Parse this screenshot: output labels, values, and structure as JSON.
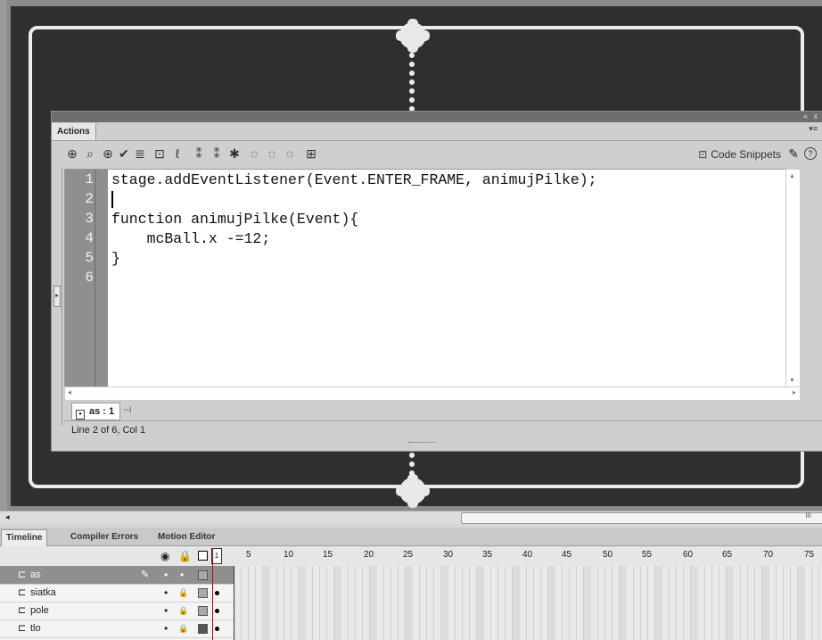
{
  "panel": {
    "tab_label": "Actions",
    "toolbar_icons": [
      "add-statement-icon",
      "find-icon",
      "target-icon",
      "check-syntax-icon",
      "auto-format-icon",
      "code-hint-icon",
      "debug-options-icon",
      "collapse-icon",
      "collapse-selection-icon",
      "expand-all-icon",
      "apply-block-comment-icon",
      "apply-line-comment-icon",
      "remove-comment-icon",
      "show-hide-toolbox-icon"
    ],
    "snippets_label": "Code Snippets",
    "help_glyph": "?",
    "top_controls": "«  x",
    "menu_glyph": "▾≡"
  },
  "editor": {
    "line_numbers": [
      "1",
      "2",
      "3",
      "4",
      "5",
      "6"
    ],
    "lines": [
      "stage.addEventListener(Event.ENTER_FRAME, animujPilke);",
      "",
      "function animujPilke(Event){",
      "    mcBall.x -=12;",
      "}",
      ""
    ]
  },
  "script_tab": {
    "label": "as : 1"
  },
  "status": {
    "text": "Line 2 of 6, Col 1"
  },
  "timeline": {
    "tabs": [
      "Timeline",
      "Compiler Errors",
      "Motion Editor"
    ],
    "frame_numbers": [
      "1",
      "5",
      "10",
      "15",
      "20",
      "25",
      "30",
      "35",
      "40",
      "45",
      "50",
      "55",
      "60",
      "65",
      "70",
      "75"
    ],
    "layers": [
      {
        "name": "as",
        "selected": true
      },
      {
        "name": "siatka",
        "selected": false
      },
      {
        "name": "pole",
        "selected": false
      },
      {
        "name": "tlo",
        "selected": false
      }
    ]
  },
  "stage_scroll": {
    "grip": "III"
  }
}
